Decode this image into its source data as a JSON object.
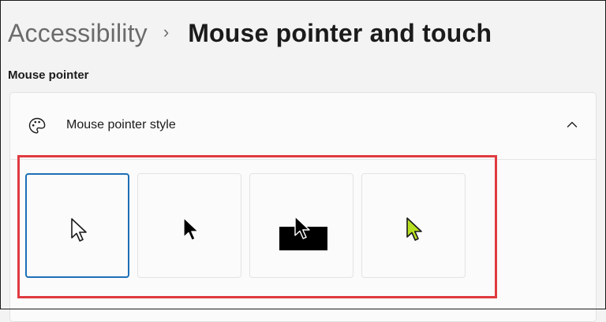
{
  "breadcrumb": {
    "parent": "Accessibility",
    "separator": "›",
    "current": "Mouse pointer and touch"
  },
  "section": {
    "label": "Mouse pointer"
  },
  "pointer_style_card": {
    "icon": "palette-icon",
    "label": "Mouse pointer style",
    "expanded": true,
    "chevron": "chevron-up-icon",
    "options": [
      {
        "name": "white",
        "icon": "white-cursor-icon",
        "selected": true
      },
      {
        "name": "black",
        "icon": "black-cursor-icon",
        "selected": false
      },
      {
        "name": "inverted",
        "icon": "inverted-cursor-icon",
        "selected": false
      },
      {
        "name": "custom",
        "icon": "custom-color-cursor-icon",
        "color": "#b6e021",
        "selected": false
      }
    ]
  },
  "colors": {
    "accent": "#1d6fb7",
    "highlight": "#e03a40",
    "custom_cursor": "#b6e021"
  }
}
